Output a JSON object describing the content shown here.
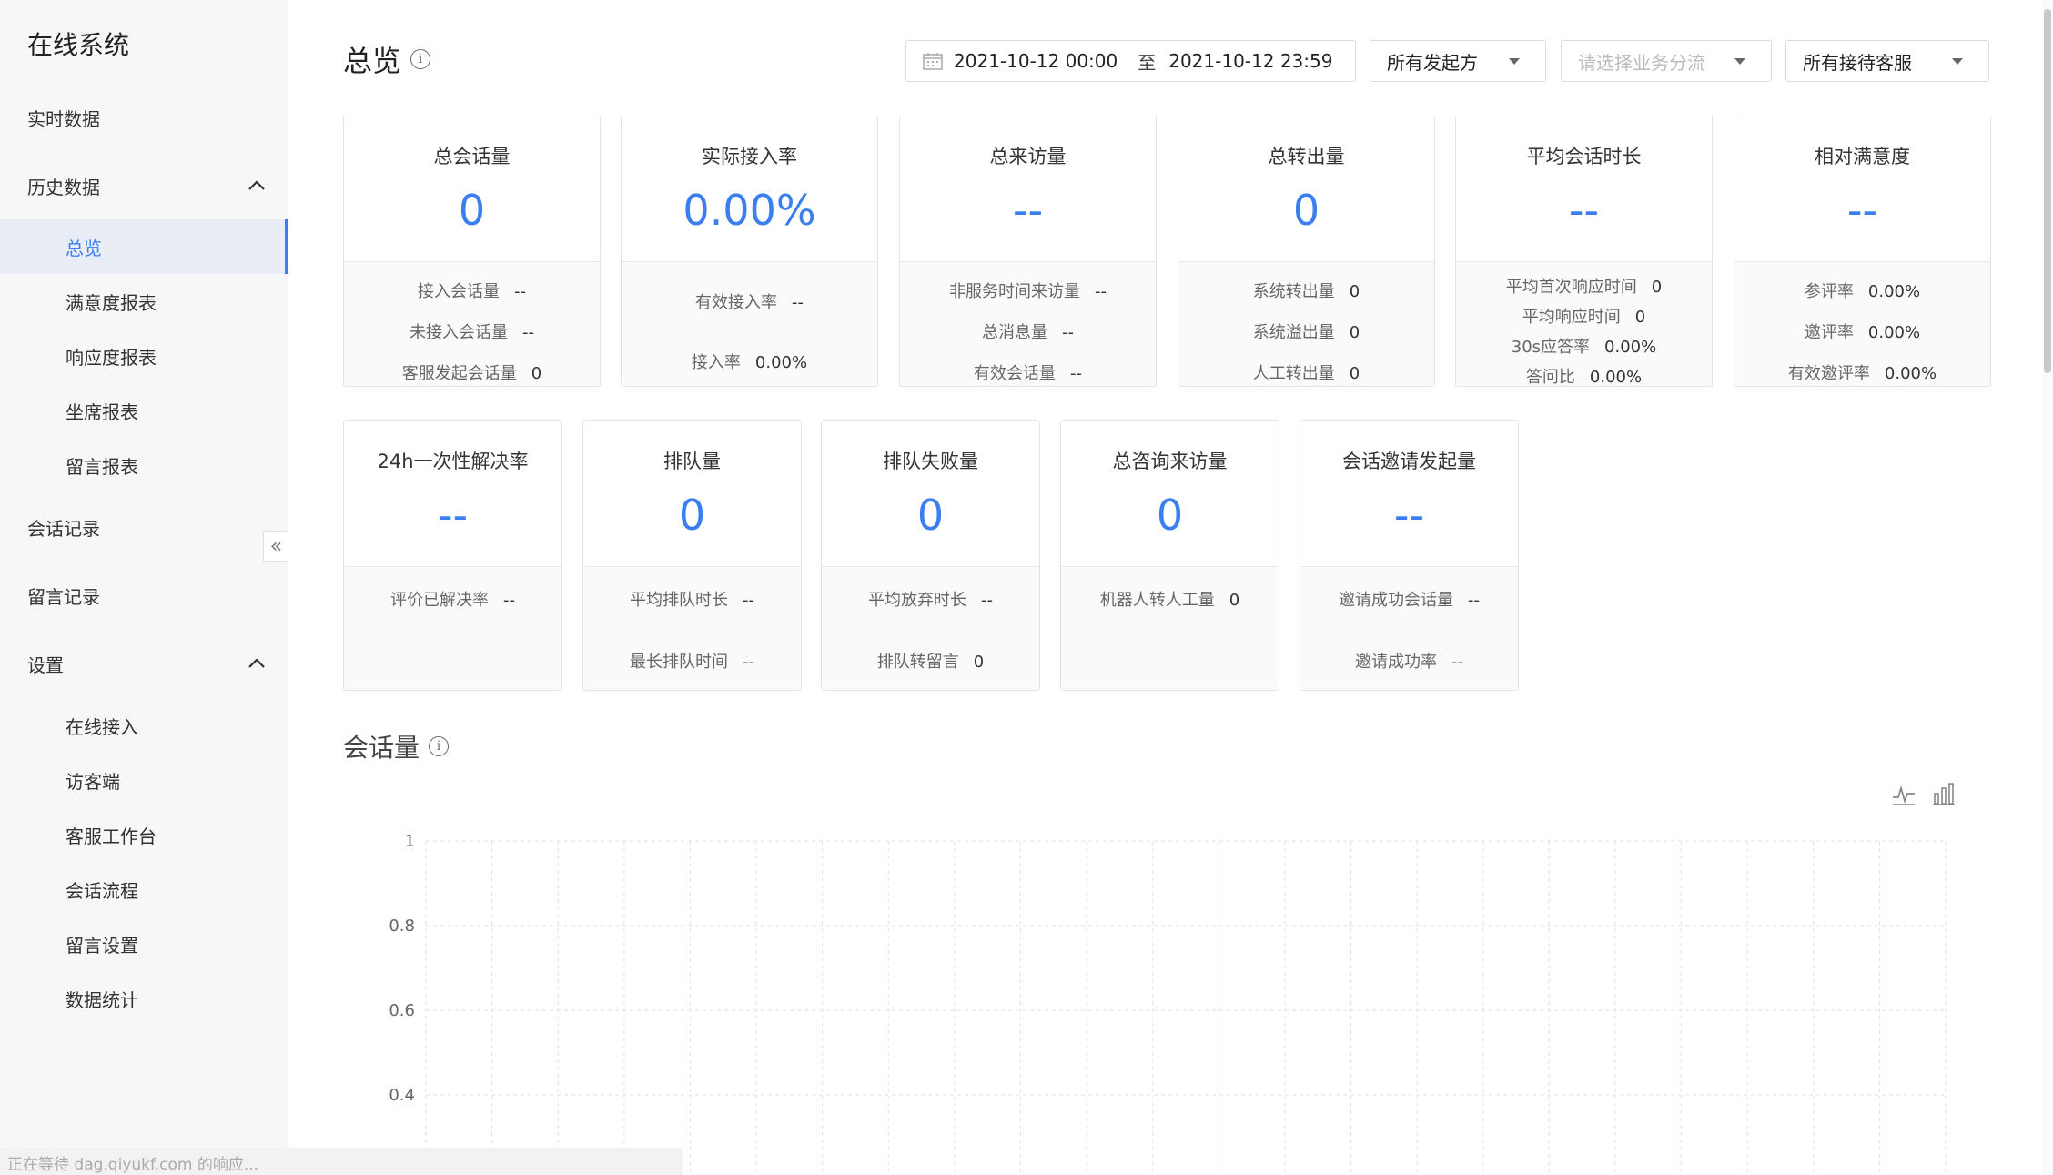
{
  "sidebar": {
    "brand": "在线系统",
    "items": [
      {
        "label": "实时数据"
      },
      {
        "label": "历史数据"
      },
      {
        "label": "总览"
      },
      {
        "label": "满意度报表"
      },
      {
        "label": "响应度报表"
      },
      {
        "label": "坐席报表"
      },
      {
        "label": "留言报表"
      },
      {
        "label": "会话记录"
      },
      {
        "label": "留言记录"
      },
      {
        "label": "设置"
      },
      {
        "label": "在线接入"
      },
      {
        "label": "访客端"
      },
      {
        "label": "客服工作台"
      },
      {
        "label": "会话流程"
      },
      {
        "label": "留言设置"
      },
      {
        "label": "数据统计"
      }
    ],
    "collapse_glyph": "«"
  },
  "status_text": "正在等待 dag.qiyukf.com 的响应...",
  "header": {
    "title": "总览",
    "info_glyph": "i",
    "date_start": "2021-10-12 00:00",
    "date_sep": "至",
    "date_end": "2021-10-12 23:59",
    "initiator": "所有发起方",
    "business_placeholder": "请选择业务分流",
    "agent": "所有接待客服"
  },
  "cards_row1": [
    {
      "title": "总会话量",
      "value": "0",
      "metrics": [
        {
          "label": "接入会话量",
          "value": "--"
        },
        {
          "label": "未接入会话量",
          "value": "--"
        },
        {
          "label": "客服发起会话量",
          "value": "0"
        }
      ]
    },
    {
      "title": "实际接入率",
      "value": "0.00%",
      "metrics": [
        {
          "label": "有效接入率",
          "value": "--"
        },
        {
          "label": "接入率",
          "value": "0.00%"
        }
      ]
    },
    {
      "title": "总来访量",
      "value": "--",
      "metrics": [
        {
          "label": "非服务时间来访量",
          "value": "--"
        },
        {
          "label": "总消息量",
          "value": "--"
        },
        {
          "label": "有效会话量",
          "value": "--"
        }
      ]
    },
    {
      "title": "总转出量",
      "value": "0",
      "metrics": [
        {
          "label": "系统转出量",
          "value": "0"
        },
        {
          "label": "系统溢出量",
          "value": "0"
        },
        {
          "label": "人工转出量",
          "value": "0"
        }
      ]
    },
    {
      "title": "平均会话时长",
      "value": "--",
      "metrics": [
        {
          "label": "平均首次响应时间",
          "value": "0"
        },
        {
          "label": "平均响应时间",
          "value": "0"
        },
        {
          "label": "30s应答率",
          "value": "0.00%"
        },
        {
          "label": "答问比",
          "value": "0.00%"
        }
      ]
    },
    {
      "title": "相对满意度",
      "value": "--",
      "metrics": [
        {
          "label": "参评率",
          "value": "0.00%"
        },
        {
          "label": "邀评率",
          "value": "0.00%"
        },
        {
          "label": "有效邀评率",
          "value": "0.00%"
        }
      ]
    }
  ],
  "cards_row2": [
    {
      "title": "24h一次性解决率",
      "value": "--",
      "metrics": [
        {
          "label": "评价已解决率",
          "value": "--"
        }
      ]
    },
    {
      "title": "排队量",
      "value": "0",
      "metrics": [
        {
          "label": "平均排队时长",
          "value": "--"
        },
        {
          "label": "最长排队时间",
          "value": "--"
        }
      ]
    },
    {
      "title": "排队失败量",
      "value": "0",
      "metrics": [
        {
          "label": "平均放弃时长",
          "value": "--"
        },
        {
          "label": "排队转留言",
          "value": "0"
        }
      ]
    },
    {
      "title": "总咨询来访量",
      "value": "0",
      "metrics": [
        {
          "label": "机器人转人工量",
          "value": "0"
        }
      ]
    },
    {
      "title": "会话邀请发起量",
      "value": "--",
      "metrics": [
        {
          "label": "邀请成功会话量",
          "value": "--"
        },
        {
          "label": "邀请成功率",
          "value": "--"
        }
      ]
    }
  ],
  "section": {
    "title": "会话量",
    "info_glyph": "i"
  },
  "colors": {
    "accent": "#3b7ef0",
    "grid": "#e2e2e2"
  },
  "chart_data": {
    "type": "line",
    "title": "",
    "series": [],
    "yticks": [
      1,
      0.8,
      0.6,
      0.4
    ],
    "ylim": [
      0,
      1
    ],
    "grid": true,
    "legend": "none"
  }
}
